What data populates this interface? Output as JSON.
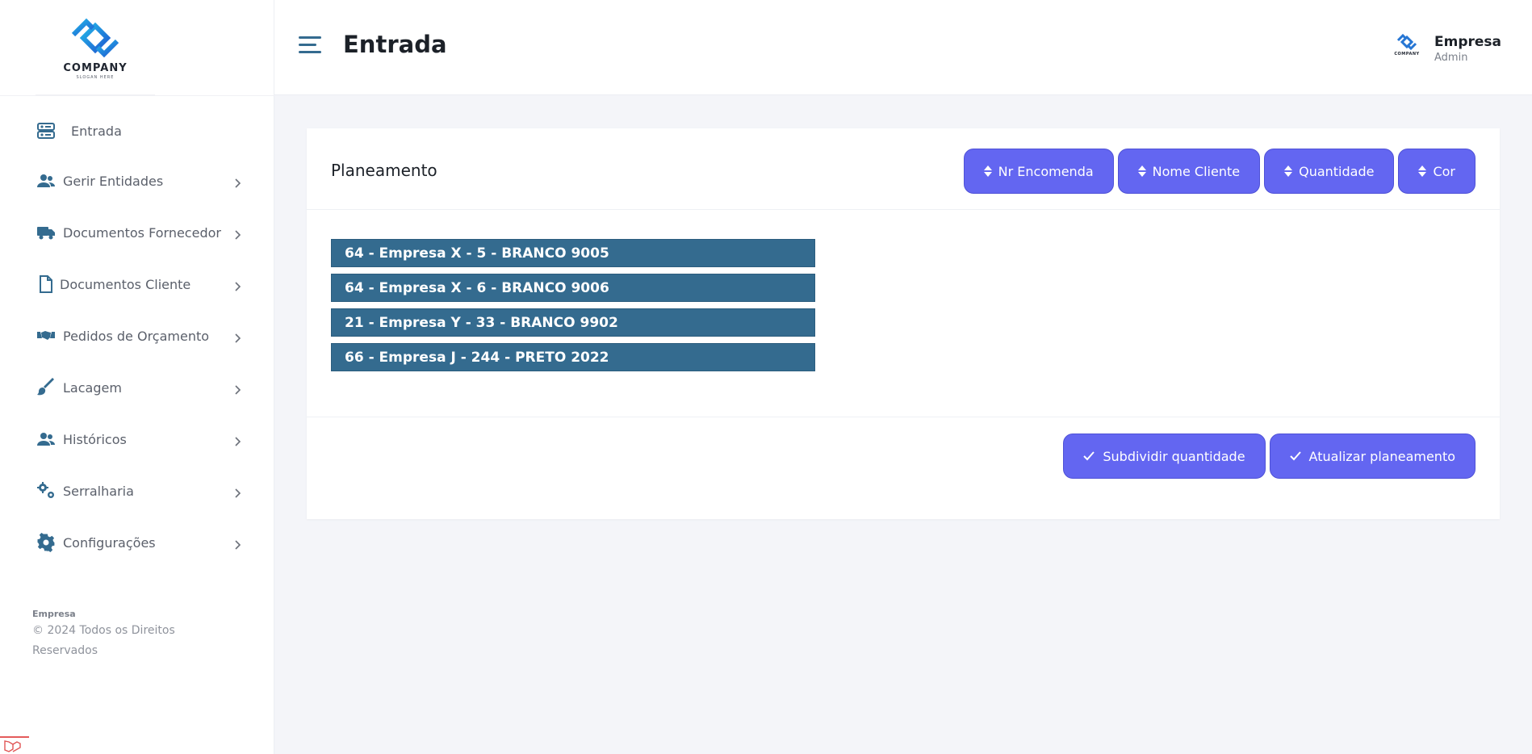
{
  "brand": {
    "logo_name": "COMPANY",
    "logo_slogan": "SLOGAN HERE",
    "accent": "#6366f1",
    "nav_icon_color": "#346b8f"
  },
  "header": {
    "title": "Entrada",
    "user_name": "Empresa",
    "user_role": "Admin",
    "avatar_label": "COMPANY"
  },
  "sidebar": {
    "items": [
      {
        "label": "Entrada",
        "icon": "dashboard-icon"
      },
      {
        "label": "Gerir Entidades",
        "icon": "users-icon"
      },
      {
        "label": "Documentos Fornecedor",
        "icon": "truck-icon"
      },
      {
        "label": "Documentos Cliente",
        "icon": "file-icon"
      },
      {
        "label": "Pedidos de Orçamento",
        "icon": "handshake-icon"
      },
      {
        "label": "Lacagem",
        "icon": "brush-icon"
      },
      {
        "label": "Históricos",
        "icon": "users-icon"
      },
      {
        "label": "Serralharia",
        "icon": "gears-icon"
      },
      {
        "label": "Configurações",
        "icon": "gear-icon"
      }
    ],
    "footer_brand": "Empresa",
    "footer_copy": "© 2024 Todos os Direitos Reservados"
  },
  "card": {
    "title": "Planeamento",
    "sort_buttons": [
      "Nr Encomenda",
      "Nome Cliente",
      "Quantidade",
      "Cor"
    ],
    "items": [
      "64 - Empresa X - 5 - BRANCO 9005",
      "64 - Empresa X - 6 - BRANCO 9006",
      "21 - Empresa Y - 33 - BRANCO 9902",
      "66 - Empresa J - 244 - PRETO 2022"
    ],
    "actions": [
      "Subdividir quantidade",
      "Atualizar planeamento"
    ]
  }
}
